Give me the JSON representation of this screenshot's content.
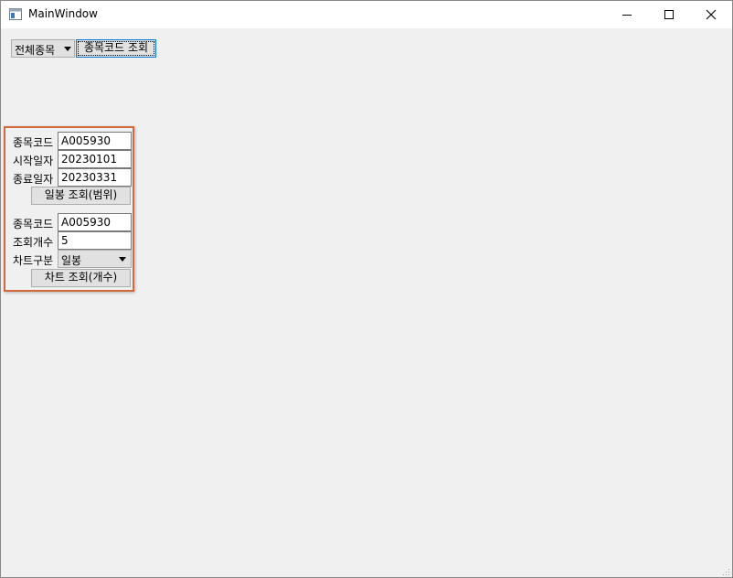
{
  "window": {
    "title": "MainWindow"
  },
  "icons": {
    "app": "window-app-icon",
    "minimize": "minimize-icon",
    "maximize": "maximize-icon",
    "close": "close-icon"
  },
  "toolbar": {
    "market_combo": "전체종목",
    "code_lookup_button": "종목코드 조회"
  },
  "range_query": {
    "code_label": "종목코드",
    "code_value": "A005930",
    "start_label": "시작일자",
    "start_value": "20230101",
    "end_label": "종료일자",
    "end_value": "20230331",
    "button": "일봉 조회(범위)"
  },
  "count_query": {
    "code_label": "종목코드",
    "code_value": "A005930",
    "count_label": "조회개수",
    "count_value": "5",
    "chart_type_label": "차트구분",
    "chart_type_value": "일봉",
    "button": "차트 조회(개수)"
  },
  "colors": {
    "panel_border": "#d2693e",
    "focus_border": "#0078d7"
  }
}
